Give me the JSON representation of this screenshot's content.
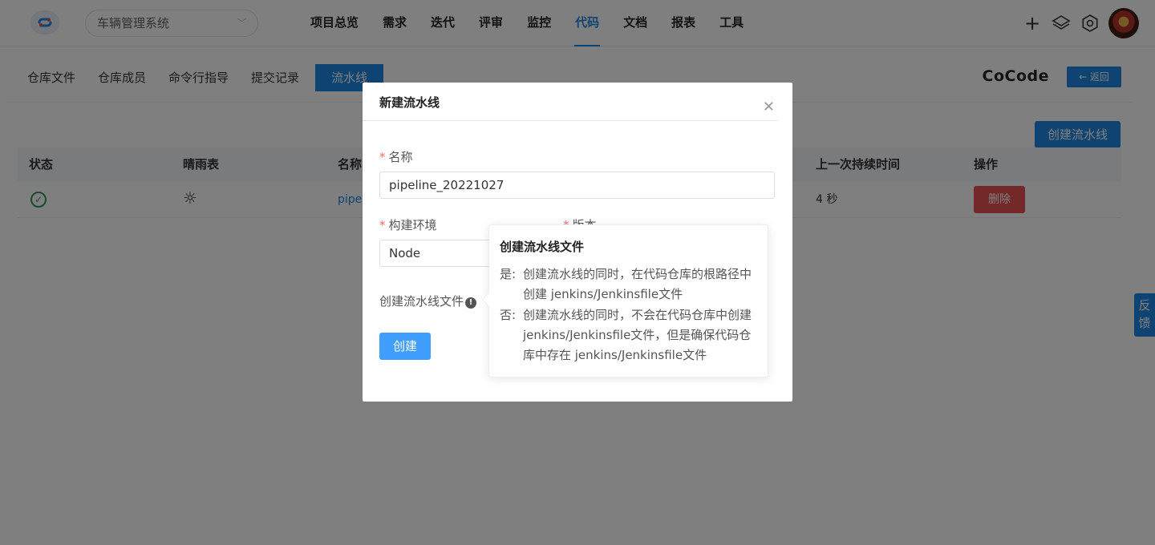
{
  "header": {
    "project_select": "车辆管理系统",
    "nav": [
      "项目总览",
      "需求",
      "迭代",
      "评审",
      "监控",
      "代码",
      "文档",
      "报表",
      "工具"
    ],
    "active_nav": "代码"
  },
  "subnav": {
    "tabs": [
      "仓库文件",
      "仓库成员",
      "命令行指导",
      "提交记录",
      "流水线"
    ],
    "active_tab": "流水线",
    "brand": "CoCode",
    "back_label": "← 返回"
  },
  "main": {
    "create_button": "创建流水线",
    "columns": [
      "状态",
      "晴雨表",
      "名称",
      "上一次持续时间",
      "操作"
    ],
    "rows": [
      {
        "name": "pipel",
        "duration": "4 秒",
        "action": "删除"
      }
    ]
  },
  "feedback_label": "反馈",
  "modal": {
    "title": "新建流水线",
    "name_label": "名称",
    "name_value": "pipeline_20221027",
    "env_label": "构建环境",
    "env_value": "Node",
    "version_label": "版本",
    "pipeline_file_label": "创建流水线文件",
    "create_button": "创建"
  },
  "tooltip": {
    "title": "创建流水线文件",
    "yes_key": "是:",
    "yes_text": "创建流水线的同时，在代码仓库的根路径中创建 jenkins/Jenkinsfile文件",
    "no_key": "否:",
    "no_text": "创建流水线的同时，不会在代码仓库中创建jenkins/Jenkinsfile文件，但是确保代码仓库中存在 jenkins/Jenkinsfile文件"
  },
  "colors": {
    "accent": "#1e88e5",
    "danger": "#e65353",
    "success": "#2e9d4f"
  },
  "icons": [
    "logo-icon",
    "chevron-down-icon",
    "plus-icon",
    "layers-icon",
    "settings-icon",
    "check-circle-icon",
    "sun-icon",
    "close-icon",
    "info-icon"
  ]
}
